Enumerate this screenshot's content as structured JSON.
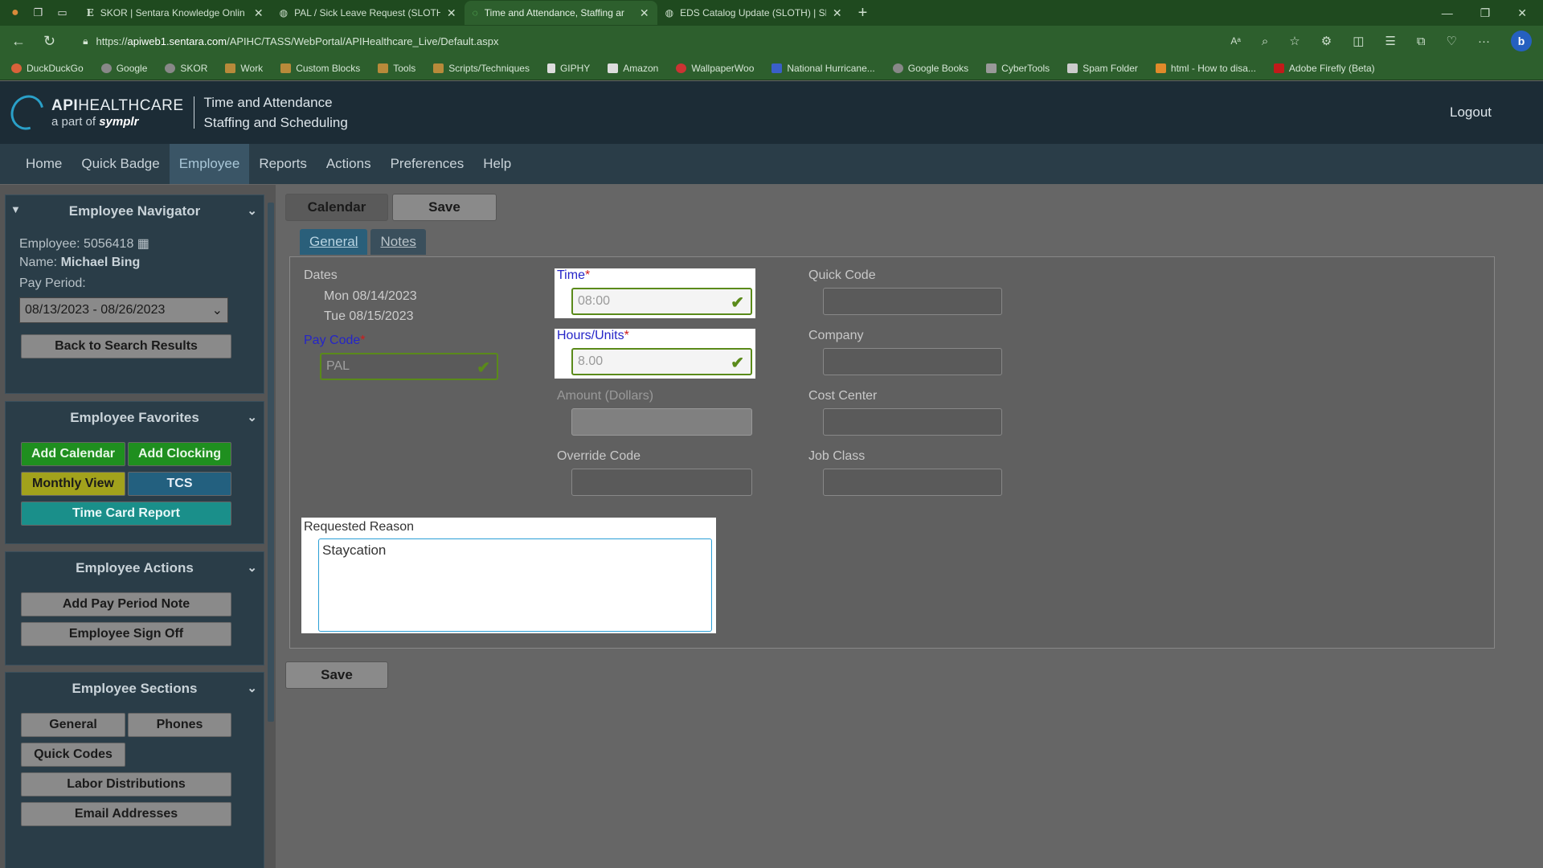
{
  "browser": {
    "tabs": [
      {
        "title": "SKOR | Sentara Knowledge Onlin",
        "icon": "E"
      },
      {
        "title": "PAL / Sick Leave Request (SLOTH",
        "icon": "globe"
      },
      {
        "title": "Time and Attendance, Staffing ar",
        "icon": "loading",
        "active": true
      },
      {
        "title": "EDS Catalog Update (SLOTH) | Sl",
        "icon": "globe"
      }
    ],
    "url_prefix": "https://",
    "url_host": "apiweb1.sentara.com",
    "url_path": "/APIHC/TASS/WebPortal/APIHealthcare_Live/Default.aspx",
    "bookmarks": [
      "DuckDuckGo",
      "Google",
      "SKOR",
      "Work",
      "Custom Blocks",
      "Tools",
      "Scripts/Techniques",
      "GIPHY",
      "Amazon",
      "WallpaperWoo",
      "National Hurricane...",
      "Google Books",
      "CyberTools",
      "Spam Folder",
      "html - How to disa...",
      "Adobe Firefly (Beta)"
    ]
  },
  "header": {
    "logo_line1_bold": "API",
    "logo_line1": "HEALTHCARE",
    "logo_line2": "a part of",
    "logo_line2_brand": "symplr",
    "title_line1": "Time and Attendance",
    "title_line2": "Staffing and Scheduling",
    "logout": "Logout"
  },
  "nav": [
    "Home",
    "Quick Badge",
    "Employee",
    "Reports",
    "Actions",
    "Preferences",
    "Help"
  ],
  "sidebar": {
    "navigator": {
      "title": "Employee Navigator",
      "employee_label": "Employee:",
      "employee_id": "5056418",
      "name_label": "Name:",
      "name": "Michael Bing",
      "pay_period_label": "Pay Period:",
      "pay_period": "08/13/2023 - 08/26/2023",
      "back_button": "Back to Search Results"
    },
    "favorites": {
      "title": "Employee Favorites",
      "buttons": [
        "Add Calendar",
        "Add Clocking",
        "Monthly View",
        "TCS",
        "Time Card Report"
      ]
    },
    "actions": {
      "title": "Employee Actions",
      "buttons": [
        "Add Pay Period Note",
        "Employee Sign Off"
      ]
    },
    "sections": {
      "title": "Employee Sections",
      "buttons": [
        "General",
        "Phones",
        "Quick Codes",
        "Labor Distributions",
        "Email Addresses"
      ]
    }
  },
  "main": {
    "top_buttons": {
      "calendar": "Calendar",
      "save": "Save"
    },
    "tabs": {
      "general": "General",
      "notes": "Notes"
    },
    "dates_label": "Dates",
    "dates": [
      "Mon 08/14/2023",
      "Tue 08/15/2023"
    ],
    "pay_code_label": "Pay Code",
    "pay_code_value": "PAL",
    "time_label": "Time",
    "time_value": "08:00",
    "hours_label": "Hours/Units",
    "hours_value": "8.00",
    "amount_label": "Amount (Dollars)",
    "override_label": "Override Code",
    "quick_code_label": "Quick Code",
    "company_label": "Company",
    "cost_center_label": "Cost Center",
    "job_class_label": "Job Class",
    "requested_reason_label": "Requested Reason",
    "requested_reason_value": "Staycation",
    "required_marker": "*",
    "bottom_save": "Save"
  }
}
